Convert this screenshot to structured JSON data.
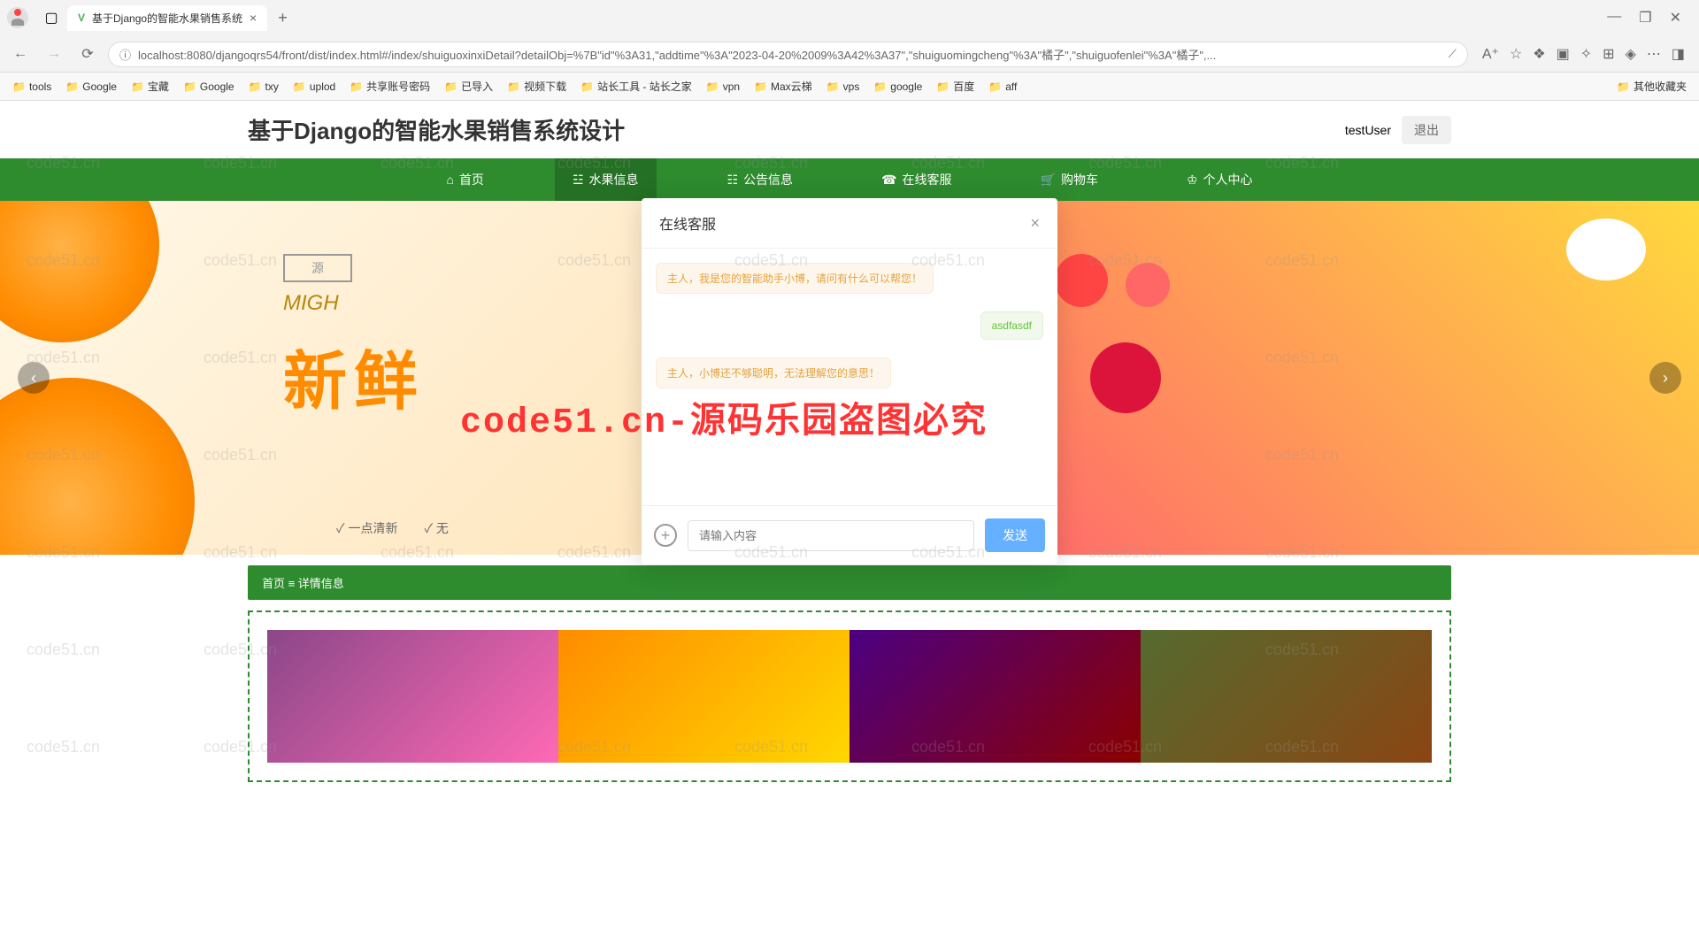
{
  "browser": {
    "tab_title": "基于Django的智能水果销售系统",
    "url": "localhost:8080/djangoqrs54/front/dist/index.html#/index/shuiguoxinxiDetail?detailObj=%7B\"id\"%3A31,\"addtime\"%3A\"2023-04-20%2009%3A42%3A37\",\"shuiguomingcheng\"%3A\"橘子\",\"shuiguofenlei\"%3A\"橘子\",...",
    "bookmarks": [
      "tools",
      "Google",
      "宝藏",
      "Google",
      "txy",
      "uplod",
      "共享账号密码",
      "已导入",
      "视频下载",
      "站长工具 - 站长之家",
      "vpn",
      "Max云梯",
      "vps",
      "google",
      "百度",
      "aff"
    ],
    "other_bookmarks": "其他收藏夹"
  },
  "site": {
    "title": "基于Django的智能水果销售系统设计",
    "user": "testUser",
    "logout": "退出",
    "nav": {
      "home": "首页",
      "fruit": "水果信息",
      "notice": "公告信息",
      "service": "在线客服",
      "cart": "购物车",
      "profile": "个人中心"
    },
    "banner": {
      "badge": "源",
      "sub": "MIGH",
      "main": "新鲜",
      "check1": "✓ 一点清新",
      "check2": "✓ 无"
    },
    "breadcrumb": "首页 ≡ 详情信息"
  },
  "modal": {
    "title": "在线客服",
    "messages": [
      {
        "role": "bot",
        "text": "主人，我是您的智能助手小博，请问有什么可以帮您！"
      },
      {
        "role": "user",
        "text": "asdfasdf"
      },
      {
        "role": "bot",
        "text": "主人，小博还不够聪明，无法理解您的意思！"
      }
    ],
    "placeholder": "请输入内容",
    "send": "发送"
  },
  "watermark": {
    "small": "code51.cn",
    "big": "code51.cn-源码乐园盗图必究"
  }
}
